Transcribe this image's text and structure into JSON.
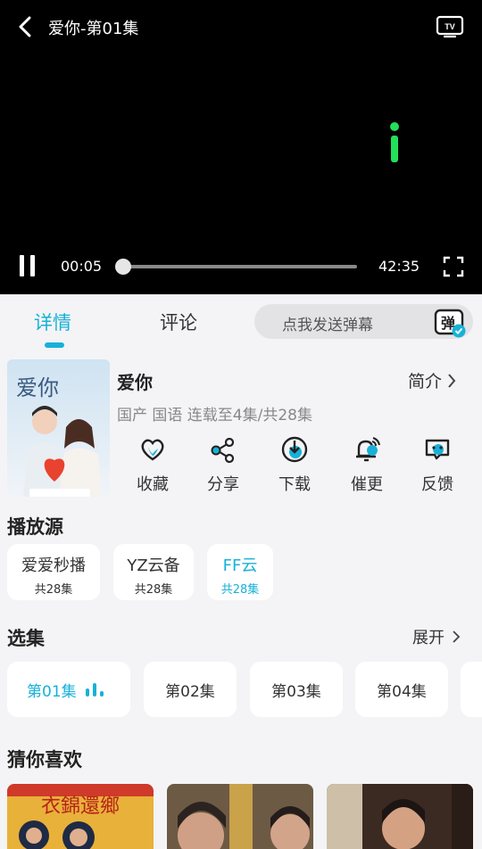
{
  "player": {
    "title": "爱你-第01集",
    "current_time": "00:05",
    "total_time": "42:35",
    "progress_fraction": 0.002
  },
  "tabs": [
    {
      "label": "详情",
      "active": true
    },
    {
      "label": "评论",
      "active": false
    }
  ],
  "danmu": {
    "placeholder": "点我发送弹幕",
    "icon_char": "弹"
  },
  "show": {
    "name": "爱你",
    "intro_label": "简介",
    "meta": "国产 国语 连载至4集/共28集",
    "poster_title": "爱你"
  },
  "actions": [
    {
      "label": "收藏",
      "icon": "heart-icon"
    },
    {
      "label": "分享",
      "icon": "share-icon"
    },
    {
      "label": "下载",
      "icon": "download-icon"
    },
    {
      "label": "催更",
      "icon": "bell-icon"
    },
    {
      "label": "反馈",
      "icon": "feedback-icon"
    }
  ],
  "sources": {
    "title": "播放源",
    "items": [
      {
        "name": "爱爱秒播",
        "count": "共28集",
        "selected": false
      },
      {
        "name": "YZ云备",
        "count": "共28集",
        "selected": false
      },
      {
        "name": "FF云",
        "count": "共28集",
        "selected": true
      }
    ]
  },
  "episodes": {
    "title": "选集",
    "expand_label": "展开",
    "items": [
      {
        "label": "第01集",
        "selected": true
      },
      {
        "label": "第02集",
        "selected": false
      },
      {
        "label": "第03集",
        "selected": false
      },
      {
        "label": "第04集",
        "selected": false
      }
    ]
  },
  "recommend": {
    "title": "猜你喜欢",
    "first_poster_text": "衣錦還鄉"
  },
  "colors": {
    "accent": "#17b1d8",
    "buffer_green": "#22e05a",
    "background": "#f4f4f6"
  }
}
